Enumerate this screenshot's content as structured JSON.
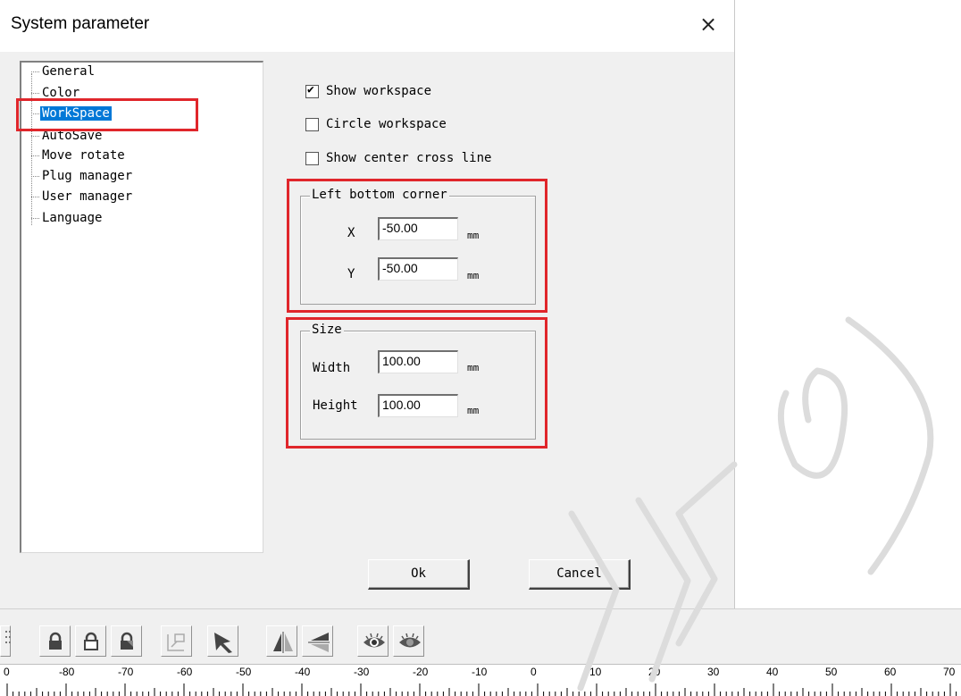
{
  "dialog": {
    "title": "System parameter",
    "close_glyph": "×"
  },
  "tree": {
    "items": [
      {
        "label": "General"
      },
      {
        "label": "Color"
      },
      {
        "label": "WorkSpace",
        "selected": true
      },
      {
        "label": "AutoSave"
      },
      {
        "label": "Move rotate"
      },
      {
        "label": "Plug manager"
      },
      {
        "label": "User manager"
      },
      {
        "label": "Language"
      }
    ]
  },
  "options": {
    "show_workspace": {
      "label": "Show workspace",
      "checked": true
    },
    "circle_workspace": {
      "label": "Circle workspace",
      "checked": false
    },
    "show_center_cross_line": {
      "label": "Show center cross line",
      "checked": false
    }
  },
  "left_bottom_corner": {
    "title": "Left bottom corner",
    "x_label": "X",
    "x_value": "-50.00",
    "y_label": "Y",
    "y_value": "-50.00",
    "unit": "mm"
  },
  "size": {
    "title": "Size",
    "width_label": "Width",
    "width_value": "100.00",
    "height_label": "Height",
    "height_value": "100.00",
    "unit": "mm"
  },
  "buttons": {
    "ok": "Ok",
    "cancel": "Cancel"
  },
  "toolbar": {
    "icons": [
      "grid-select-icon",
      "lock-icon",
      "unlock-icon",
      "lock-alt-icon",
      "align-icon",
      "cursor-icon",
      "mirror-horizontal-icon",
      "mirror-vertical-icon",
      "eye-icon",
      "eye-hidden-icon"
    ]
  },
  "ruler": {
    "labels": [
      "0",
      "-80",
      "-70",
      "-60",
      "-50",
      "-40",
      "-30",
      "-20",
      "-10",
      "0",
      "10",
      "20",
      "30",
      "40",
      "50",
      "60",
      "70"
    ]
  },
  "colors": {
    "highlight": "#e0262b",
    "selection": "#0078d7",
    "dialog_bg": "#f0f0f0"
  }
}
